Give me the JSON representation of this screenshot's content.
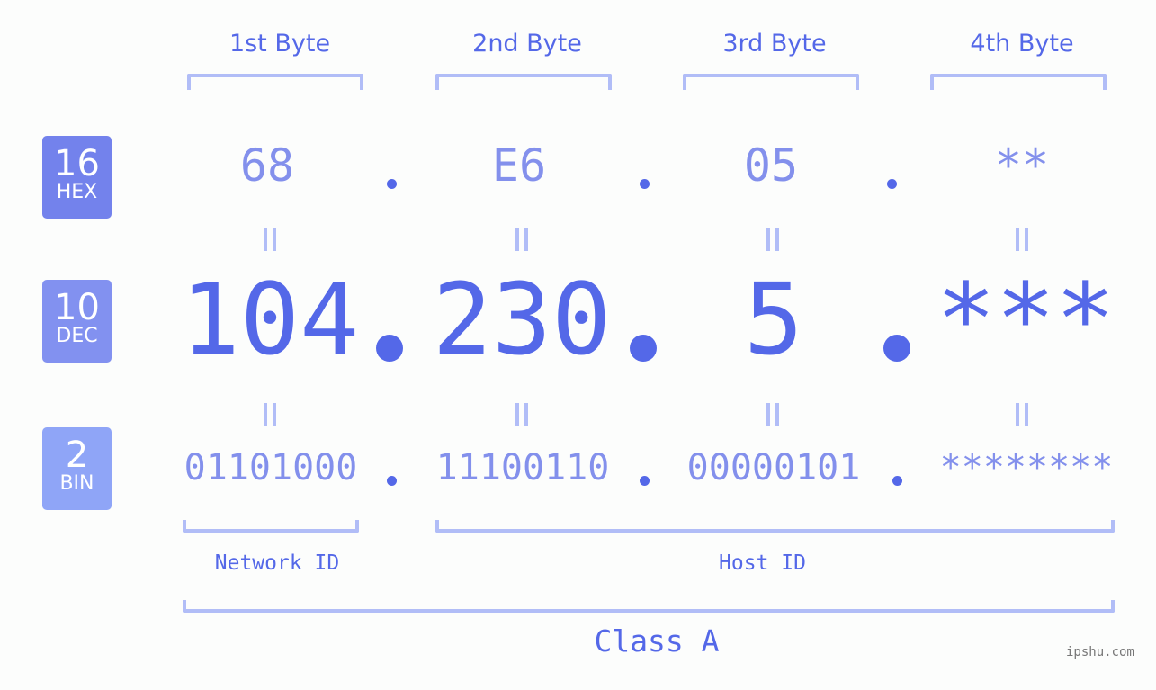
{
  "byte_headers": [
    "1st Byte",
    "2nd Byte",
    "3rd Byte",
    "4th Byte"
  ],
  "badges": {
    "hex": {
      "number": "16",
      "label": "HEX",
      "color": "#7382ec"
    },
    "dec": {
      "number": "10",
      "label": "DEC",
      "color": "#8291f0"
    },
    "bin": {
      "number": "2",
      "label": "BIN",
      "color": "#8fa5f7"
    }
  },
  "hex_values": [
    "68",
    "E6",
    "05",
    "**"
  ],
  "dec_values": [
    "104",
    "230",
    "5",
    "***"
  ],
  "bin_values": [
    "01101000",
    "11100110",
    "00000101",
    "********"
  ],
  "separator": ".",
  "network_id_label": "Network ID",
  "host_id_label": "Host ID",
  "class_label": "Class A",
  "watermark": "ipshu.com",
  "colors": {
    "primary": "#5468e8",
    "secondary": "#8390ec",
    "bracket": "#b1bdf7"
  }
}
